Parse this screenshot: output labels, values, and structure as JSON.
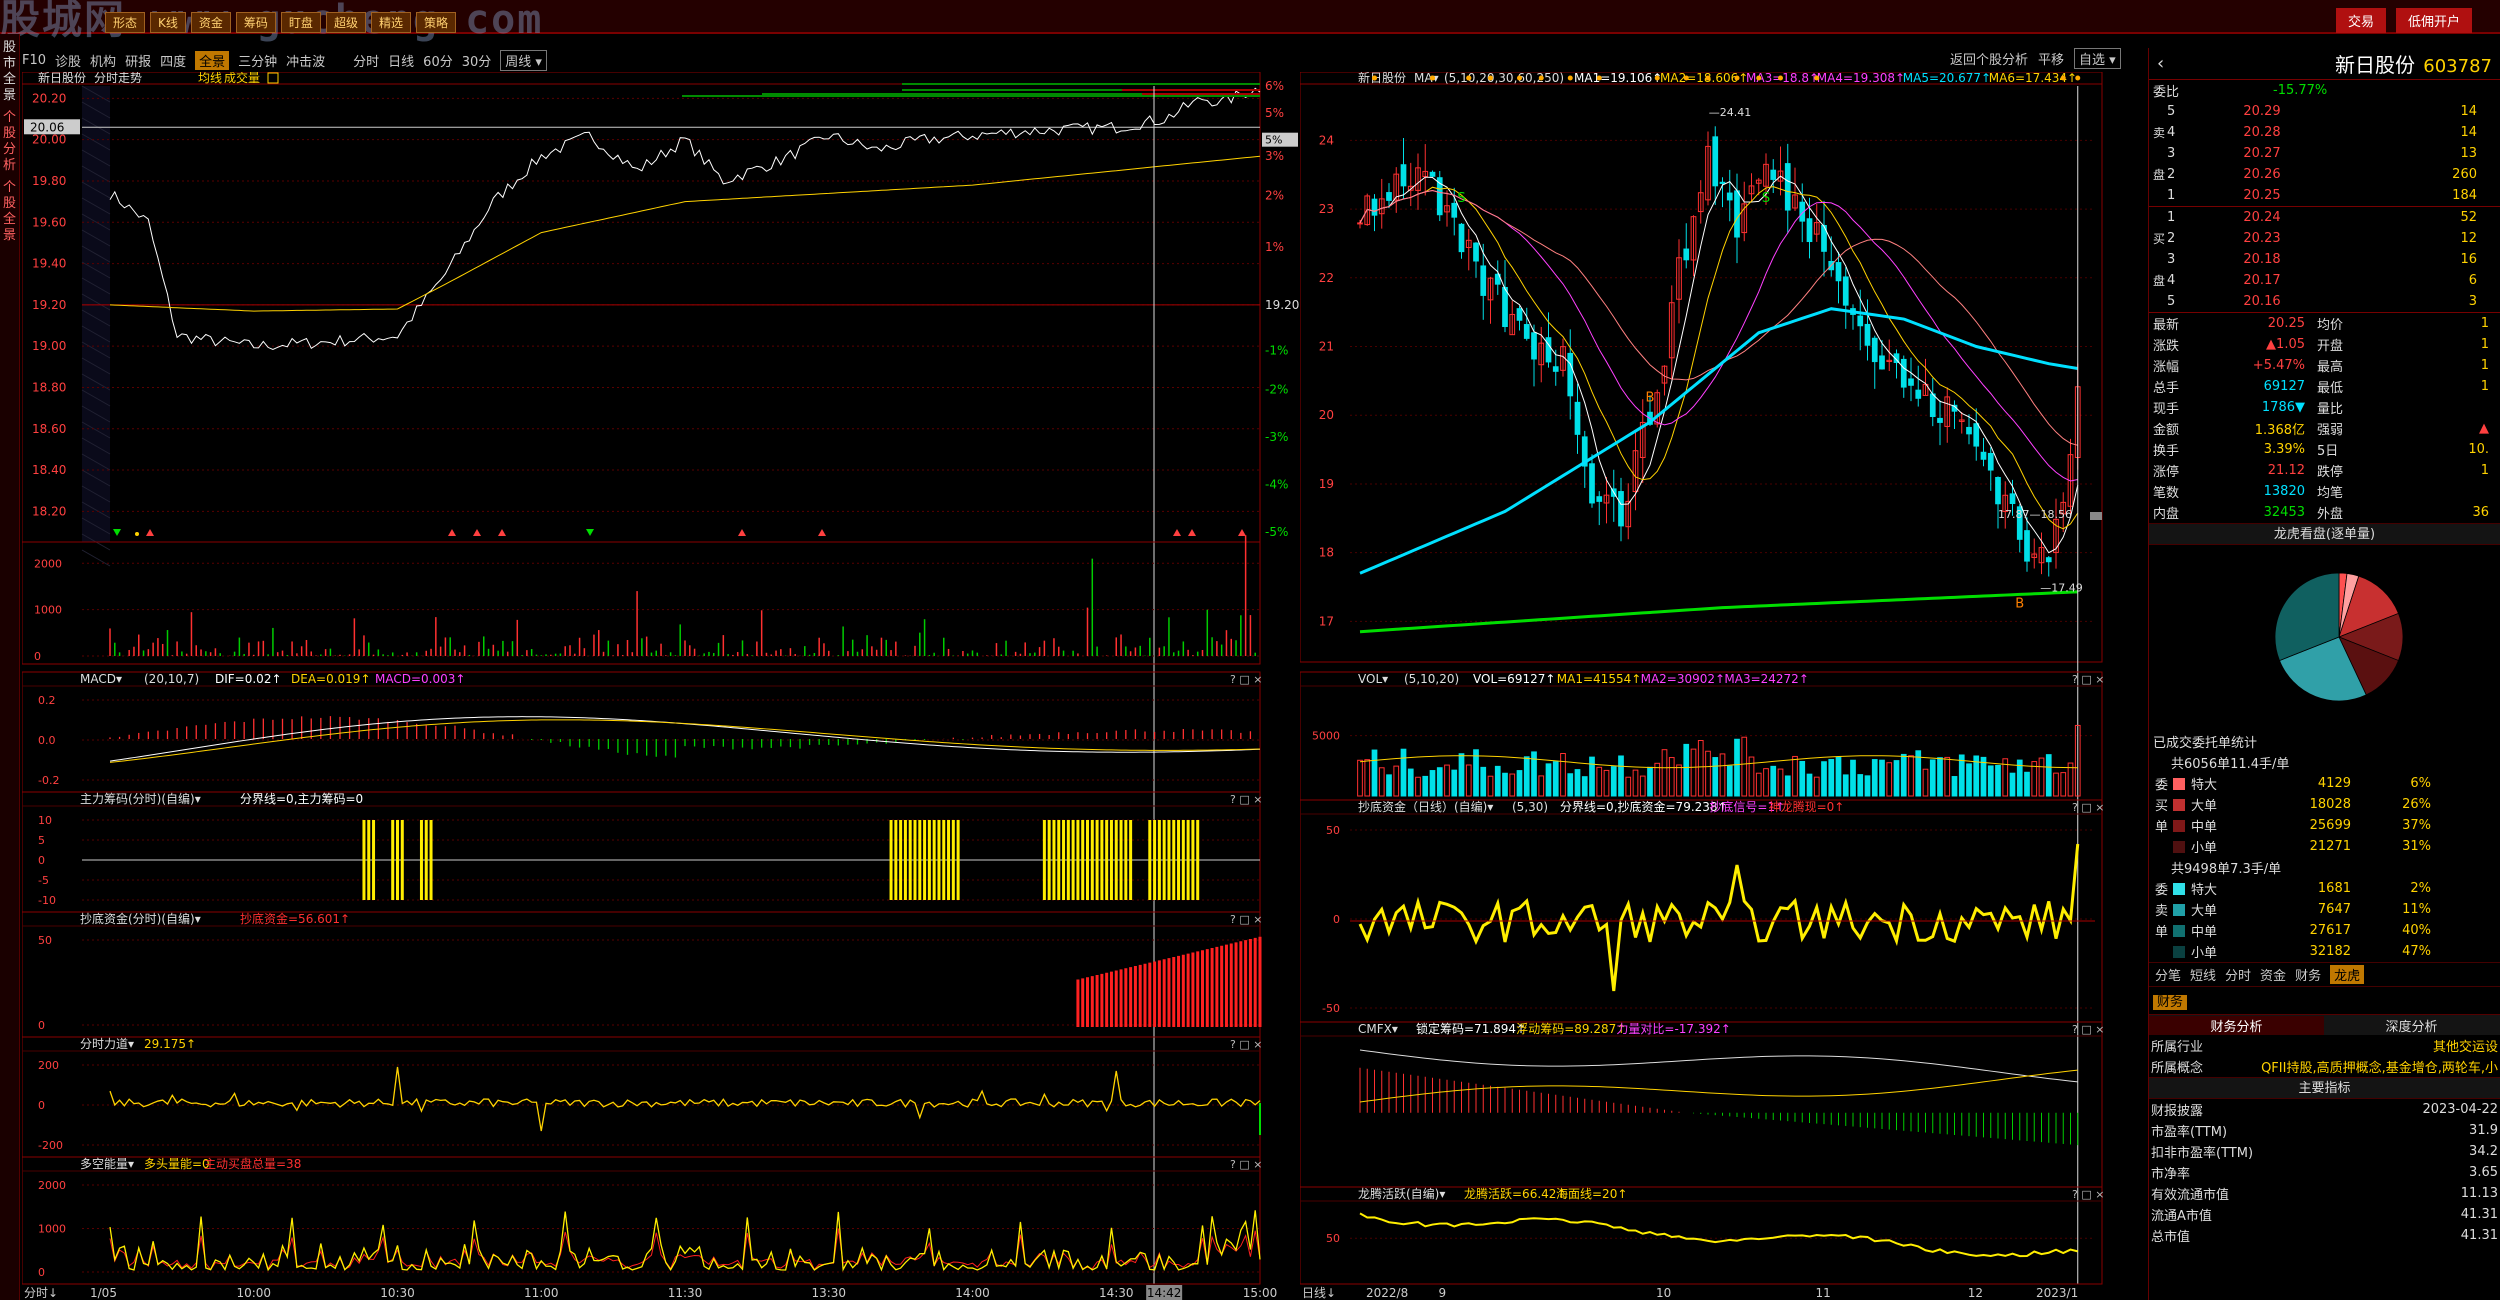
{
  "top": {
    "watermark": "股城网 www.gucheng.com",
    "menu_items": [
      "形态",
      "K线",
      "资金",
      "筹码",
      "盯盘",
      "超级",
      "精选",
      "策略"
    ],
    "trade_btn": "交易",
    "margin_btn": "低佣开户"
  },
  "left_vtabs": [
    "股市全景",
    "个股分析",
    "个股全景"
  ],
  "left_toolbar": {
    "items": [
      "F10",
      "诊股",
      "机构",
      "研报",
      "四度"
    ],
    "selected": "全景",
    "items2": [
      "三分钟",
      "冲击波"
    ],
    "periods": [
      "分时",
      "日线",
      "60分",
      "30分",
      "周线"
    ]
  },
  "right_toolbar": {
    "back": "返回个股分析",
    "flat": "平移",
    "selfsel": "自选"
  },
  "intraday": {
    "title": "新日股份",
    "sub1": "分时走势",
    "sub2": "均线",
    "sub3": "成交量",
    "price_ticks": [
      "20.20",
      "20.06",
      "20.00",
      "19.80",
      "19.60",
      "19.40",
      "19.20",
      "19.00",
      "18.80",
      "18.60",
      "18.40",
      "18.20"
    ],
    "pct_ticks": [
      "6%",
      "5%",
      "4.5%",
      "3%",
      "2%",
      "1%",
      "19.20",
      "-1%",
      "-2%",
      "-3%",
      "-4%",
      "-5%"
    ],
    "vol_ticks": [
      "2000",
      "1000",
      "0"
    ],
    "time_labels": [
      "1/05",
      "10:00",
      "10:30",
      "11:00",
      "11:30",
      "13:30",
      "14:00",
      "14:30",
      "14:42",
      "15:00"
    ],
    "bottom_label": "分时"
  },
  "panels_left": [
    {
      "name": "MACD",
      "params": "(20,10,7)",
      "vals": [
        {
          "t": "DIF=0.02",
          "c": "#ffffff"
        },
        {
          "t": "DEA=0.019",
          "c": "#ffd200"
        },
        {
          "t": "MACD=0.003",
          "c": "#ff40ff"
        }
      ],
      "ticks": [
        "0.2",
        "0.0",
        "-0.2"
      ]
    },
    {
      "name": "主力筹码(分时)(自编)",
      "params": "",
      "vals": [
        {
          "t": "分界线=0,主力筹码=0",
          "c": "#ffffff"
        }
      ],
      "ticks": [
        "10",
        "5",
        "0",
        "-5",
        "-10"
      ]
    },
    {
      "name": "抄底资金(分时)(自编)",
      "params": "",
      "vals": [
        {
          "t": "抄底资金=56.601",
          "c": "#ff3030"
        }
      ],
      "ticks": [
        "50",
        "0"
      ]
    },
    {
      "name": "分时力道",
      "params": "",
      "vals": [
        {
          "t": "29.175",
          "c": "#ffd200"
        }
      ],
      "ticks": [
        "200",
        "0",
        "-200"
      ]
    },
    {
      "name": "多空能量",
      "params": "",
      "vals": [
        {
          "t": "多头量能=0",
          "c": "#ffd200"
        },
        {
          "t": "主动买盘总量=38",
          "c": "#ff3030"
        }
      ],
      "ticks": [
        "2000",
        "1000",
        "0"
      ]
    }
  ],
  "kline": {
    "title": "新日股份",
    "ma_label": "MA",
    "ma_params": "(5,10,20,30,60,250)",
    "ma_vals": [
      {
        "t": "MA1=19.106",
        "c": "#ffffff"
      },
      {
        "t": "MA2=18.606",
        "c": "#ffd200"
      },
      {
        "t": "MA3=18.8",
        "c": "#ff40ff"
      },
      {
        "t": "MA4=19.308",
        "c": "#ff40ff"
      },
      {
        "t": "MA5=20.677",
        "c": "#00e0ff"
      },
      {
        "t": "MA6=17.434",
        "c": "#ffd200"
      }
    ],
    "y_ticks": [
      "24",
      "23",
      "22",
      "21",
      "20",
      "19",
      "18",
      "17"
    ],
    "high_label": "24.41",
    "low_label": "17.49",
    "mid_label": "17.87",
    "mid_label2": "18.56",
    "date_labels": [
      "2022/8",
      "9",
      "10",
      "11",
      "12",
      "2023/1"
    ],
    "bottom_label": "日线"
  },
  "panels_right": [
    {
      "name": "VOL",
      "params": "(5,10,20)",
      "vals": [
        {
          "t": "VOL=69127",
          "c": "#ffffff"
        },
        {
          "t": "MA1=41554",
          "c": "#ffd200"
        },
        {
          "t": "MA2=30902",
          "c": "#ff40ff"
        },
        {
          "t": "MA3=24272",
          "c": "#ff40ff"
        }
      ],
      "ticks": [
        "5000"
      ]
    },
    {
      "name": "抄底资金（日线）(自编)",
      "params": "(5,30)",
      "vals": [
        {
          "t": "分界线=0,抄底资金=79.238",
          "c": "#ffffff"
        },
        {
          "t": "抄底信号=1",
          "c": "#ff40ff"
        },
        {
          "t": "神龙腾现=0",
          "c": "#ff3030"
        }
      ],
      "ticks": [
        "50",
        "0",
        "-50"
      ]
    },
    {
      "name": "CMFX",
      "params": "",
      "vals": [
        {
          "t": "锁定筹码=71.894",
          "c": "#ffffff"
        },
        {
          "t": "浮动筹码=89.287",
          "c": "#ffd200"
        },
        {
          "t": "力量对比=-17.392",
          "c": "#ff40ff"
        }
      ],
      "ticks": []
    },
    {
      "name": "龙腾活跃(自编)",
      "params": "",
      "vals": [
        {
          "t": "龙腾活跃=66.42",
          "c": "#ffd200"
        },
        {
          "t": "海面线=20",
          "c": "#ffd200"
        }
      ],
      "ticks": [
        "50"
      ]
    }
  ],
  "quote": {
    "name": "新日股份",
    "code": "603787",
    "weibi_label": "委比",
    "weibi": "-15.77%",
    "asks": [
      [
        "5",
        "20.29",
        "14"
      ],
      [
        "4",
        "20.28",
        "14"
      ],
      [
        "3",
        "20.27",
        "13"
      ],
      [
        "2",
        "20.26",
        "260"
      ],
      [
        "1",
        "20.25",
        "184"
      ]
    ],
    "bids": [
      [
        "1",
        "20.24",
        "52"
      ],
      [
        "2",
        "20.23",
        "12"
      ],
      [
        "3",
        "20.18",
        "16"
      ],
      [
        "4",
        "20.17",
        "6"
      ],
      [
        "5",
        "20.16",
        "3"
      ]
    ],
    "ask_side": "卖盘",
    "bid_side": "买盘",
    "stats": [
      [
        "最新",
        "20.25",
        "均价",
        "1"
      ],
      [
        "涨跌",
        "▲1.05",
        "开盘",
        "1"
      ],
      [
        "涨幅",
        "+5.47%",
        "最高",
        "1"
      ],
      [
        "总手",
        "69127",
        "最低",
        "1"
      ],
      [
        "现手",
        "1786▼",
        "量比",
        ""
      ],
      [
        "金额",
        "1.368亿",
        "强弱",
        "▲"
      ],
      [
        "换手",
        "3.39%",
        "5日",
        "10."
      ],
      [
        "涨停",
        "21.12",
        "跌停",
        "1"
      ],
      [
        "笔数",
        "13820",
        "均笔",
        ""
      ],
      [
        "内盘",
        "32453",
        "外盘",
        "36"
      ]
    ],
    "pie_title": "龙虎看盘(逐单量)",
    "pie": [
      2,
      6,
      26,
      37,
      31
    ],
    "entrust_title": "已成交委托单统计",
    "buy_summary": "共6056单11.4手/单",
    "buy": [
      [
        "委",
        "特大",
        "4129",
        "6%"
      ],
      [
        "买",
        "大单",
        "18028",
        "26%"
      ],
      [
        "单",
        "中单",
        "25699",
        "37%"
      ],
      [
        "",
        "小单",
        "21271",
        "31%"
      ]
    ],
    "sell_summary": "共9498单7.3手/单",
    "sell": [
      [
        "委",
        "特大",
        "1681",
        "2%"
      ],
      [
        "卖",
        "大单",
        "7647",
        "11%"
      ],
      [
        "单",
        "中单",
        "27617",
        "40%"
      ],
      [
        "",
        "小单",
        "32182",
        "47%"
      ]
    ],
    "tabs": [
      "分笔",
      "短线",
      "分时",
      "资金",
      "财务",
      "龙虎"
    ],
    "tab_selected": "龙虎",
    "fin_tab": "财务",
    "fin_sub": [
      "财务分析",
      "深度分析"
    ],
    "industry_label": "所属行业",
    "industry": "其他交运设",
    "concept_label": "所属概念",
    "concept": "QFII持股,高质押概念,基金增仓,两轮车,小",
    "main_idx": "主要指标",
    "indicators": [
      [
        "财报披露",
        "2023-04-22"
      ],
      [
        "市盈率(TTM)",
        "31.9"
      ],
      [
        "扣非市盈率(TTM)",
        "34.2"
      ],
      [
        "市净率",
        "3.65"
      ],
      [
        "有效流通市值",
        "11.13"
      ],
      [
        "流通A市值",
        "41.31"
      ],
      [
        "总市值",
        "41.31"
      ]
    ]
  }
}
